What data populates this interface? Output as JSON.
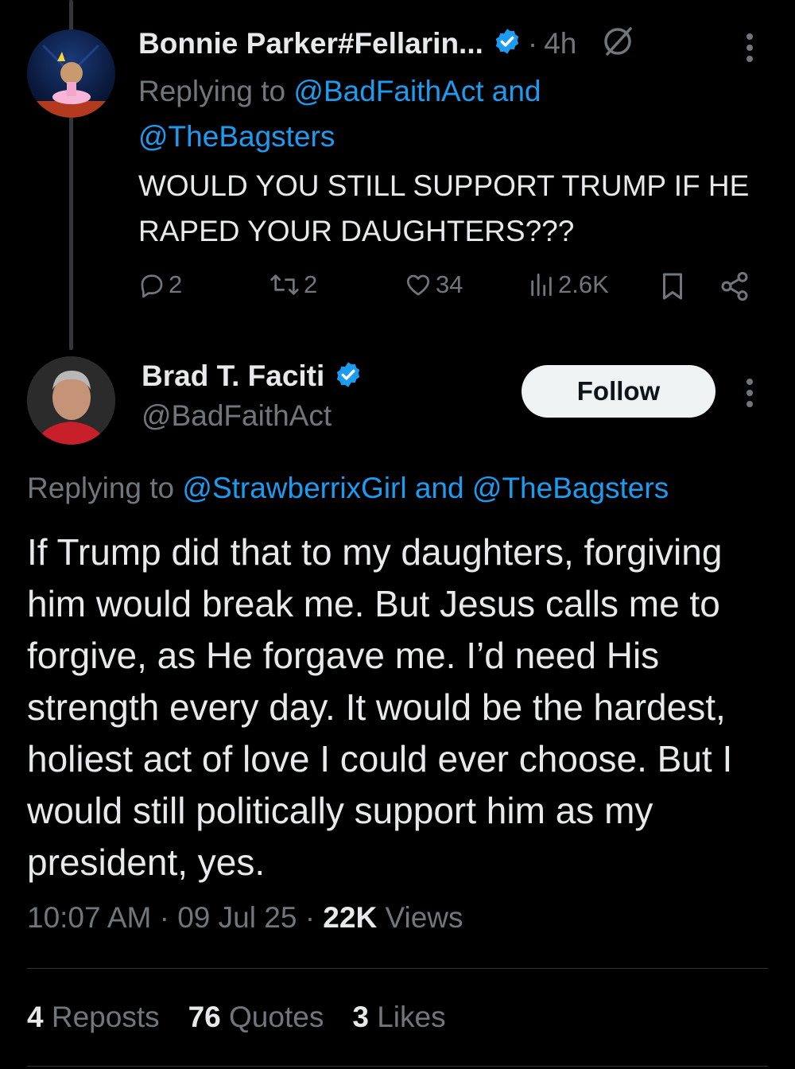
{
  "parent_tweet": {
    "author_name": "Bonnie Parker#Fellarin...",
    "time": "4h",
    "reply_prefix": "Replying to",
    "reply_mentions": "@BadFaithAct and @TheBagsters",
    "text": "WOULD YOU STILL SUPPORT TRUMP IF HE RAPED YOUR DAUGHTERS???",
    "replies": "2",
    "reposts": "2",
    "likes": "34",
    "views": "2.6K"
  },
  "main_tweet": {
    "author_name": "Brad T. Faciti",
    "handle": "@BadFaithAct",
    "follow_label": "Follow",
    "reply_prefix": "Replying to",
    "reply_mentions": "@StrawberrixGirl and @TheBagsters",
    "text": "If Trump did that to my daughters, forgiving him would break me. But Jesus calls me to forgive, as He forgave me. I’d need His strength every day. It would be the hardest, holiest act of love I could ever choose. But I would still politically support him as my president, yes.",
    "time": "10:07 AM",
    "date": "09 Jul 25",
    "views_count": "22K",
    "views_label": "Views",
    "reposts_count": "4",
    "reposts_label": "Reposts",
    "quotes_count": "76",
    "quotes_label": "Quotes",
    "likes_count": "3",
    "likes_label": "Likes"
  },
  "colors": {
    "background": "#000000",
    "text": "#e7e9ea",
    "muted": "#71767b",
    "accent": "#1d9bf0",
    "divider": "#2f3336"
  },
  "icons": [
    "verified-badge-icon",
    "grok-icon",
    "more-icon",
    "reply-icon",
    "repost-icon",
    "like-icon",
    "views-icon",
    "bookmark-icon",
    "share-icon"
  ]
}
